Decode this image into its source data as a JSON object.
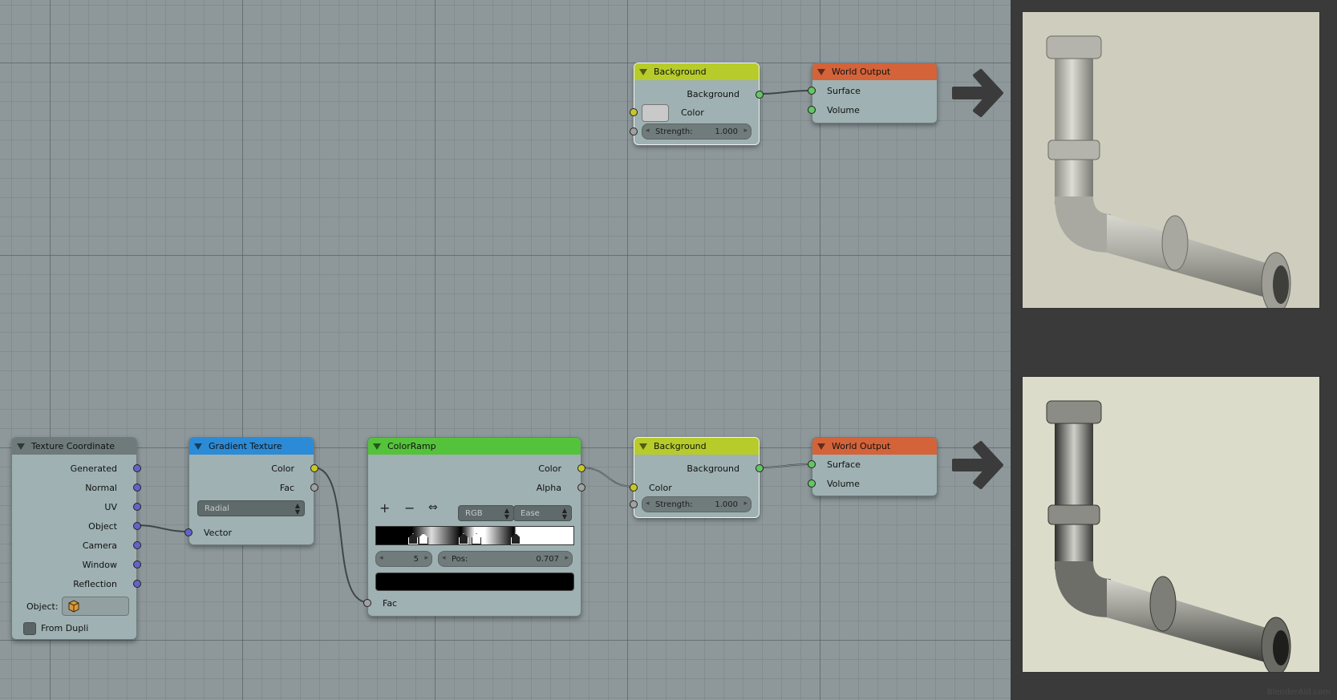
{
  "nodes": {
    "bg_top": {
      "title": "Background",
      "output": "Background",
      "color_label": "Color",
      "strength_label": "Strength:",
      "strength_value": "1.000"
    },
    "world_top": {
      "title": "World Output",
      "surface": "Surface",
      "volume": "Volume"
    },
    "tex_coord": {
      "title": "Texture Coordinate",
      "outputs": [
        "Generated",
        "Normal",
        "UV",
        "Object",
        "Camera",
        "Window",
        "Reflection"
      ],
      "object_label": "Object:",
      "from_dupli": "From Dupli"
    },
    "gradient": {
      "title": "Gradient Texture",
      "color": "Color",
      "fac": "Fac",
      "type_value": "Radial",
      "vector": "Vector"
    },
    "colorramp": {
      "title": "ColorRamp",
      "color": "Color",
      "alpha": "Alpha",
      "mode": "RGB",
      "interp": "Ease",
      "stop_index": "5",
      "pos_label": "Pos:",
      "pos_value": "0.707",
      "fac": "Fac"
    },
    "bg_bottom": {
      "title": "Background",
      "output": "Background",
      "color_label": "Color",
      "strength_label": "Strength:",
      "strength_value": "1.000"
    },
    "world_bottom": {
      "title": "World Output",
      "surface": "Surface",
      "volume": "Volume"
    }
  },
  "colors": {
    "header_background": "#b7cc2a",
    "header_world": "#d4633a",
    "header_texcoord": "#6f7b7b",
    "header_gradient": "#2c8bd6",
    "header_colorramp": "#55c23b",
    "node_body": "#9fb1b2",
    "preview_top_bg": "#cfcdbd",
    "preview_bottom_bg": "#dcdccb"
  },
  "icons": [
    "arrow-right-icon",
    "plus-icon",
    "minus-icon",
    "flip-icon",
    "cube-icon"
  ],
  "preview": {
    "watermark": "BlenderAid.com"
  }
}
